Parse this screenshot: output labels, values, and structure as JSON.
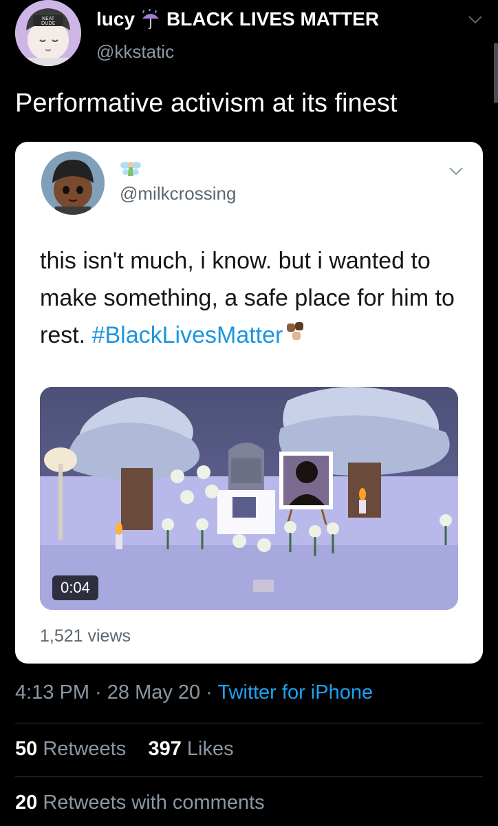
{
  "tweet": {
    "author_name": "lucy",
    "author_name_suffix": "BLACK LIVES MATTER",
    "author_handle": "@kkstatic",
    "avatar_badge_text": "NEAT DUDE",
    "text": "Performative activism at its finest",
    "timestamp": "4:13 PM · 28 May 20 · ",
    "source": "Twitter for iPhone"
  },
  "quoted_tweet": {
    "author_handle": "@milkcrossing",
    "text": "this isn't much, i know. but i wanted to make something, a safe place for him to rest. ",
    "hashtag": "#BlackLivesMatter",
    "video_duration": "0:04",
    "views": "1,521 views"
  },
  "stats": {
    "retweets_count": "50",
    "retweets_label": "Retweets",
    "likes_count": "397",
    "likes_label": "Likes",
    "comments_count": "20",
    "comments_label": "Retweets with comments"
  },
  "colors": {
    "background": "#000000",
    "link": "#1da1f2",
    "hashtag": "#1b95e0",
    "secondary_text": "#8b98a5"
  },
  "icons": [
    "umbrella-with-rain-icon",
    "chevron-down-icon",
    "fairy-icon",
    "raised-fists-icon"
  ]
}
